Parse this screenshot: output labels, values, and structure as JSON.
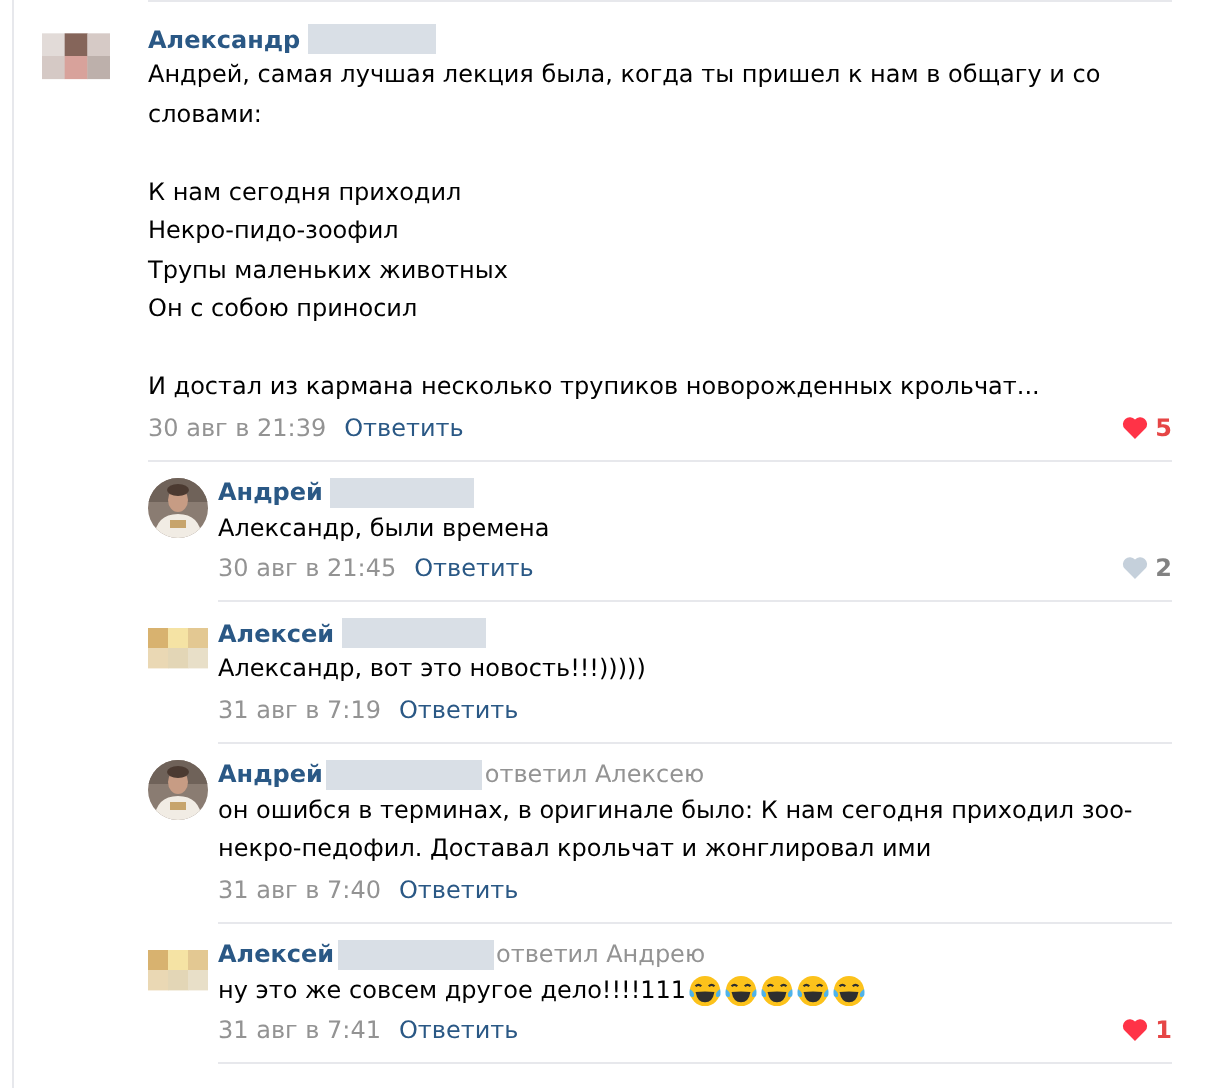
{
  "comments": [
    {
      "author": "Александр",
      "avatar": {
        "kind": "pixel-brown"
      },
      "text": "Андрей, самая лучшая лекция была, когда ты пришел к нам в общагу и со словами:\n\nК нам сегодня приходил\nНекро-пидо-зоофил\nТрупы маленьких животных\nОн с собою приносил\n\nИ достал из кармана несколько трупиков новорожденных крольчат...",
      "date": "30 авг в 21:39",
      "reply_label": "Ответить",
      "likes": {
        "count": "5",
        "liked": true
      },
      "replies": [
        {
          "author": "Андрей",
          "text": "Александр, были времена",
          "date": "30 авг в 21:45",
          "reply_label": "Ответить",
          "likes": {
            "count": "2",
            "liked": false
          }
        },
        {
          "author": "Алексей",
          "avatar": {
            "kind": "pixel-yellow"
          },
          "text": "Александр, вот это новость!!!)))))",
          "date": "31 авг в 7:19",
          "reply_label": "Ответить"
        },
        {
          "author": "Андрей",
          "reply_to": "ответил Алексею",
          "text": "он ошибся в терминах, в оригинале было: К нам сегодня приходил зоо-некро-педофил. Доставал крольчат и жонглировал ими",
          "date": "31 авг в 7:40",
          "reply_label": "Ответить"
        },
        {
          "author": "Алексей",
          "avatar": {
            "kind": "pixel-yellow"
          },
          "reply_to": "ответил Андрею",
          "text": "ну это же совсем другое дело!!!!111",
          "emojis": [
            {
              "kind": "tears-of-joy"
            },
            {
              "kind": "tears-of-joy"
            },
            {
              "kind": "tears-of-joy"
            },
            {
              "kind": "tears-of-joy"
            },
            {
              "kind": "tears-of-joy"
            }
          ],
          "date": "31 авг в 7:41",
          "reply_label": "Ответить",
          "likes": {
            "count": "1",
            "liked": true
          }
        }
      ]
    }
  ]
}
